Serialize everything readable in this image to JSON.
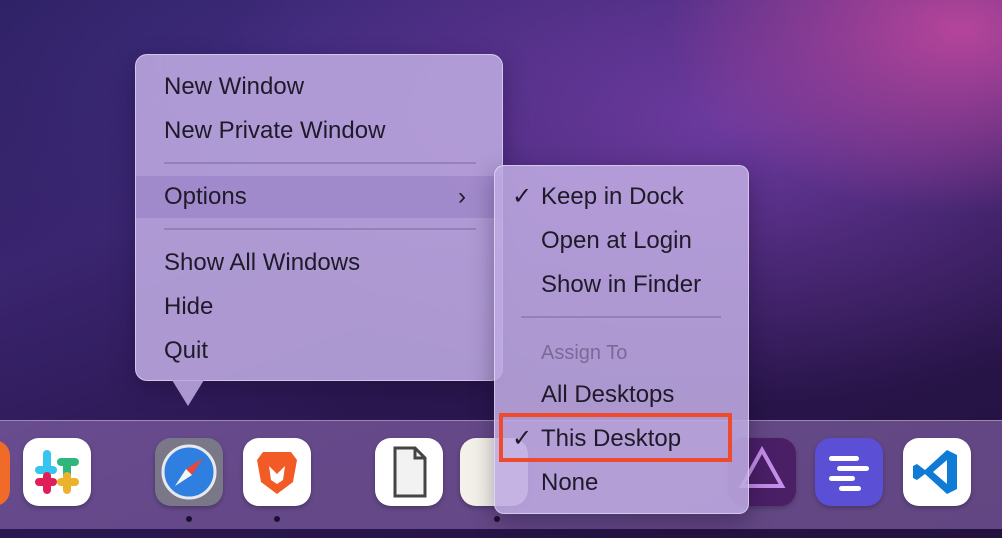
{
  "context_menu": {
    "items": [
      {
        "label": "New Window"
      },
      {
        "label": "New Private Window"
      },
      {
        "label": "Options"
      },
      {
        "label": "Show All Windows"
      },
      {
        "label": "Hide"
      },
      {
        "label": "Quit"
      }
    ],
    "highlighted": "Options"
  },
  "options_submenu": {
    "items": [
      {
        "label": "Keep in Dock",
        "checked": true
      },
      {
        "label": "Open at Login",
        "checked": false
      },
      {
        "label": "Show in Finder",
        "checked": false
      }
    ],
    "assign_header": "Assign To",
    "assign_items": [
      {
        "label": "All Desktops",
        "checked": false
      },
      {
        "label": "This Desktop",
        "checked": true
      },
      {
        "label": "None",
        "checked": false
      }
    ],
    "check_glyph": "✓",
    "chevron_glyph": "›"
  },
  "dock": {
    "icons": [
      {
        "name": "slack-icon",
        "running": false
      },
      {
        "name": "safari-icon",
        "running": true
      },
      {
        "name": "brave-icon",
        "running": true
      },
      {
        "name": "libreoffice-icon",
        "running": false
      },
      {
        "name": "document-icon",
        "running": true
      },
      {
        "name": "affinity-photo-icon",
        "running": false
      },
      {
        "name": "text-editor-icon",
        "running": false
      },
      {
        "name": "vscode-icon",
        "running": false
      }
    ]
  },
  "colors": {
    "annotation_box": "#ef4a2d",
    "menu_background": "#beaae1"
  }
}
